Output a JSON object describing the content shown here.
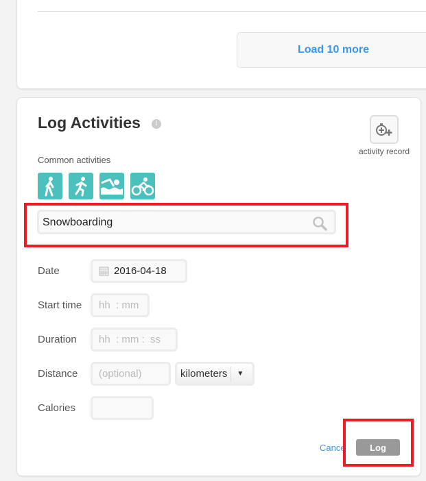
{
  "top_card": {
    "load_more_label": "Load 10 more"
  },
  "log_activities": {
    "title": "Log Activities",
    "info_icon": "info-icon",
    "activity_record_label": "activity record",
    "common_activities_label": "Common activities",
    "common_activities": [
      {
        "icon": "walking-icon"
      },
      {
        "icon": "running-icon"
      },
      {
        "icon": "swimming-icon"
      },
      {
        "icon": "cycling-icon"
      }
    ],
    "search_value": "Snowboarding",
    "date_label": "Date",
    "date_value": "2016-04-18",
    "start_time_label": "Start time",
    "start_time_placeholder": "hh  : mm",
    "duration_label": "Duration",
    "duration_placeholder": "hh  : mm :  ss",
    "distance_label": "Distance",
    "distance_placeholder": "(optional)",
    "distance_unit": "kilometers",
    "calories_label": "Calories",
    "calories_value": "",
    "cancel_label": "Cancel",
    "log_label": "Log"
  },
  "colors": {
    "accent": "#4cc0bc",
    "link": "#3a96e8",
    "highlight": "#ed1c24"
  }
}
